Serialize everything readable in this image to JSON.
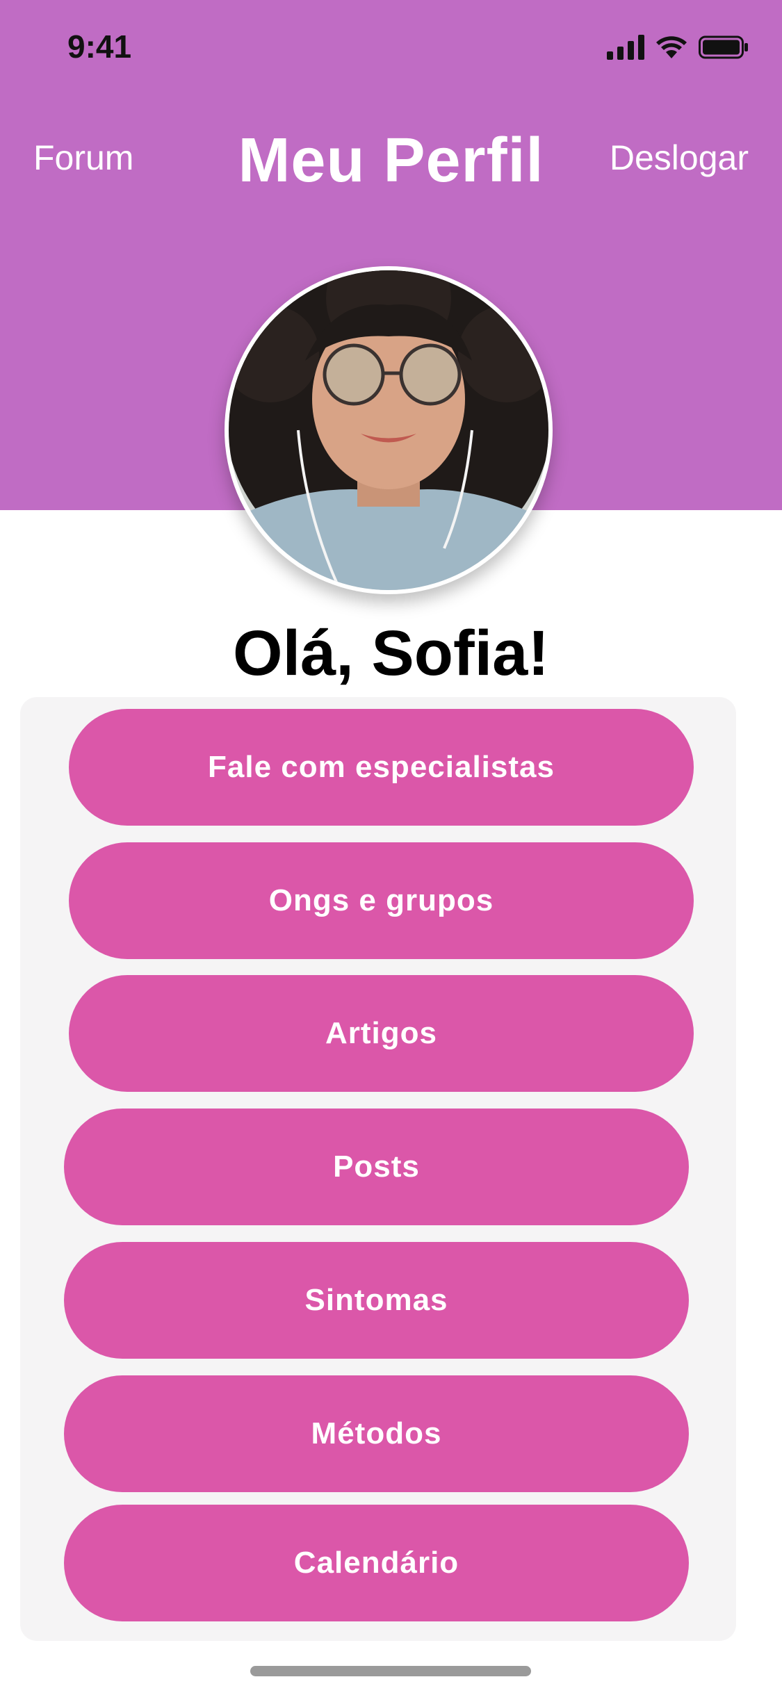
{
  "status_bar": {
    "time": "9:41"
  },
  "header": {
    "left_link": "Forum",
    "title": "Meu Perfil",
    "right_link": "Deslogar",
    "color": "#c06cc4"
  },
  "profile": {
    "greeting": "Olá, Sofia!"
  },
  "menu": {
    "button_color": "#db57a9",
    "items": [
      {
        "label": "Fale com especialistas"
      },
      {
        "label": "Ongs e grupos"
      },
      {
        "label": "Artigos"
      },
      {
        "label": "Posts"
      },
      {
        "label": "Sintomas"
      },
      {
        "label": "Métodos"
      },
      {
        "label": "Calendário"
      }
    ]
  }
}
